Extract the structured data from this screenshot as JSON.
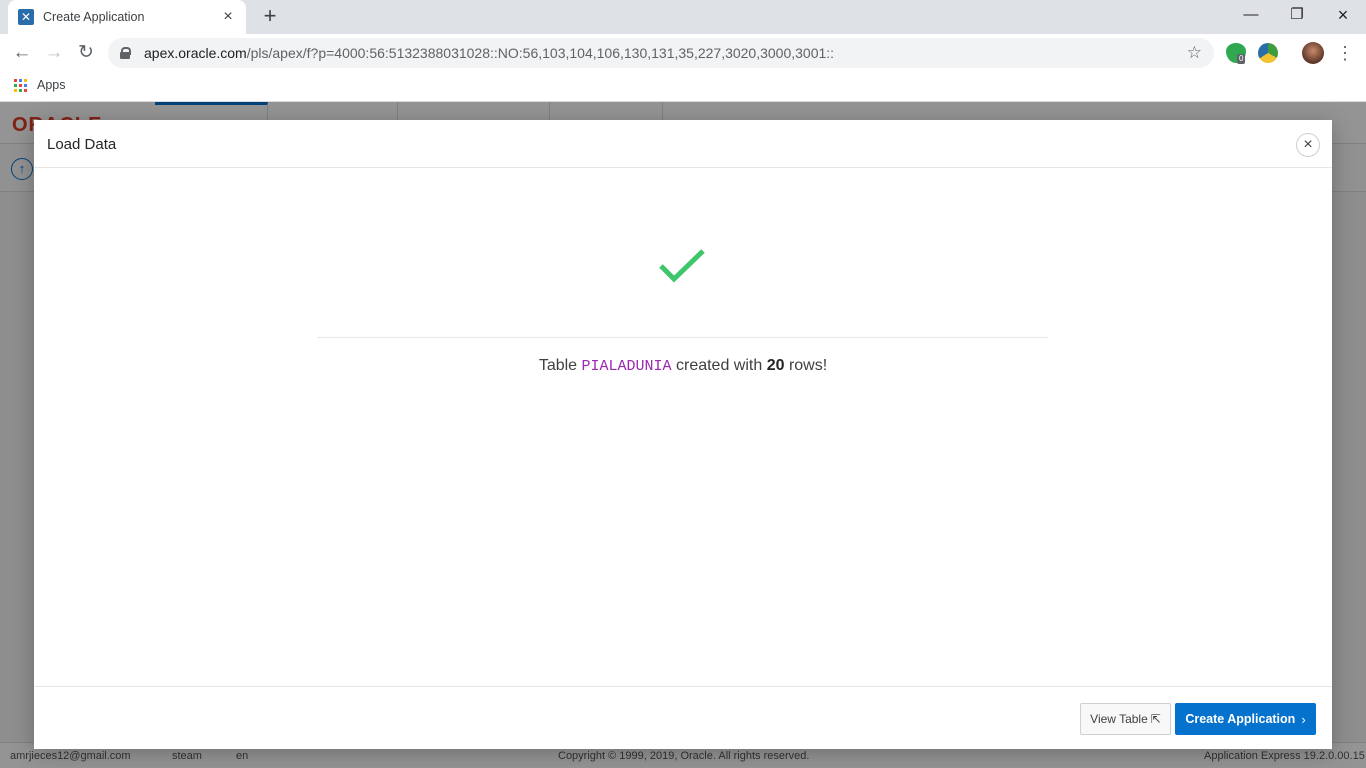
{
  "browser": {
    "tab_title": "Create Application",
    "url_host": "apex.oracle.com",
    "url_path": "/pls/apex/f?p=4000:56:5132388031028::NO:56,103,104,106,130,131,35,227,3020,3000,3001::",
    "bookmarks": {
      "apps_label": "Apps"
    },
    "extension_badge": "0"
  },
  "apex": {
    "logo": "ORACLE",
    "footer": {
      "user": "amrjieces12@gmail.com",
      "workspace": "steam",
      "language": "en",
      "copyright": "Copyright © 1999, 2019, Oracle. All rights reserved.",
      "version": "Application Express 19.2.0.00.15"
    }
  },
  "dialog": {
    "title": "Load Data",
    "message": {
      "prefix": "Table",
      "table_name": "PIALADUNIA",
      "middle": "created with",
      "row_count": "20",
      "suffix": "rows!"
    },
    "buttons": {
      "view_table": "View Table",
      "create_application": "Create Application"
    }
  },
  "colors": {
    "accent": "#0572ce",
    "success_check": "#3fc66b",
    "table_name": "#9c27b0"
  }
}
